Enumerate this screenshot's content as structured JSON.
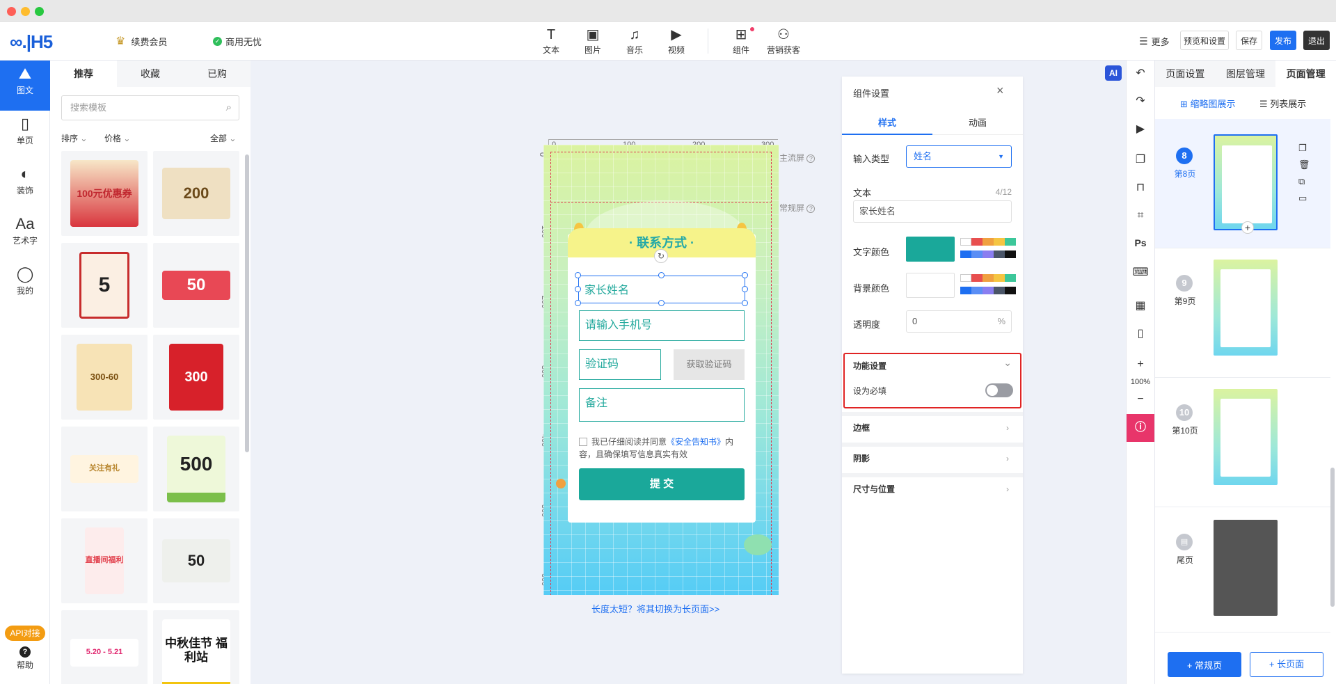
{
  "topbar": {
    "logo": "∞.|H5",
    "vip": "续费会员",
    "commercial": "商用无忧",
    "tools": [
      {
        "icon": "T",
        "label": "文本"
      },
      {
        "icon": "▣",
        "label": "图片"
      },
      {
        "icon": "♫",
        "label": "音乐"
      },
      {
        "icon": "▶",
        "label": "视频"
      },
      {
        "icon": "⊞",
        "label": "组件"
      },
      {
        "icon": "⚇",
        "label": "营销获客"
      }
    ],
    "more": "更多",
    "preview": "预览和设置",
    "save": "保存",
    "publish": "发布",
    "exit": "退出"
  },
  "leftnav": [
    {
      "icon": "⛰",
      "label": "图文"
    },
    {
      "icon": "▯",
      "label": "单页"
    },
    {
      "icon": "◐",
      "label": "装饰"
    },
    {
      "icon": "Aa",
      "label": "艺术字"
    },
    {
      "icon": "◯",
      "label": "我的"
    }
  ],
  "api_badge": "API对接",
  "help": "帮助",
  "templates": {
    "tabs": [
      "推荐",
      "收藏",
      "已购"
    ],
    "search_placeholder": "搜索模板",
    "sort": "排序",
    "price": "价格",
    "all": "全部",
    "cards": [
      "100元优惠券",
      "200",
      "5",
      "50",
      "300-60",
      "300",
      "关注有礼",
      "500",
      "直播间福利",
      "50",
      "5.20 - 5.21",
      "中秋佳节 福利站"
    ]
  },
  "canvas": {
    "ruler": [
      "0",
      "100",
      "200",
      "300"
    ],
    "ruler_v": [
      "0",
      "100",
      "200",
      "300",
      "400",
      "500",
      "600"
    ],
    "main_screen": "主流屏",
    "normal_screen": "常规屏",
    "form_title": "· 联系方式 ·",
    "field_name": "家长姓名",
    "field_phone": "请输入手机号",
    "field_code": "验证码",
    "get_code": "获取验证码",
    "field_note": "备注",
    "agree_1": "我已仔细阅读并同意",
    "agree_link": "《安全告知书》",
    "agree_2": "内容，且确保填写信息真实有效",
    "submit": "提 交",
    "switch_long": "长度太短？将其切换为长页面>>"
  },
  "settings": {
    "title": "组件设置",
    "tab_style": "样式",
    "tab_anim": "动画",
    "input_type_label": "输入类型",
    "input_type_value": "姓名",
    "text_label": "文本",
    "text_count": "4/12",
    "text_value": "家长姓名",
    "text_color_label": "文字颜色",
    "text_color": "#1aa89a",
    "bg_color_label": "背景颜色",
    "opacity_label": "透明度",
    "opacity_value": "0",
    "opacity_unit": "%",
    "function_title": "功能设置",
    "required_label": "设为必填",
    "required_on": false,
    "border": "边框",
    "shadow": "阴影",
    "size_pos": "尺寸与位置",
    "swatches": [
      "#ffffff",
      "#e84f4f",
      "#f0a040",
      "#f5c542",
      "#3cc79a",
      "#1e6ff1",
      "#5a8ef5",
      "#8a7ef0",
      "#4a5568",
      "#111111"
    ]
  },
  "vtools": {
    "zoom": "100%",
    "ps": "Ps",
    "ai": "AI"
  },
  "pages": {
    "tabs": [
      "页面设置",
      "图层管理",
      "页面管理"
    ],
    "view_thumb": "缩略图展示",
    "view_list": "列表展示",
    "items": [
      {
        "num": "8",
        "label": "第8页"
      },
      {
        "num": "9",
        "label": "第9页"
      },
      {
        "num": "10",
        "label": "第10页"
      },
      {
        "num": "▤",
        "label": "尾页"
      }
    ],
    "add_normal": "+ 常规页",
    "add_long": "+ 长页面"
  }
}
